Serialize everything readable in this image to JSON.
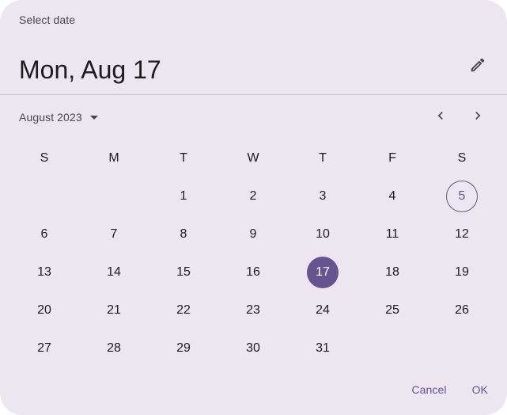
{
  "dialog": {
    "label": "Select date",
    "headline": "Mon, Aug 17",
    "edit_icon": "pencil-icon",
    "month_label": "August 2023",
    "prev_icon": "chevron-left-icon",
    "next_icon": "chevron-right-icon",
    "weekdays": [
      "S",
      "M",
      "T",
      "W",
      "T",
      "F",
      "S"
    ],
    "days": [
      "",
      "",
      "1",
      "2",
      "3",
      "4",
      "5",
      "6",
      "7",
      "8",
      "9",
      "10",
      "11",
      "12",
      "13",
      "14",
      "15",
      "16",
      "17",
      "18",
      "19",
      "20",
      "21",
      "22",
      "23",
      "24",
      "25",
      "26",
      "27",
      "28",
      "29",
      "30",
      "31",
      "",
      ""
    ],
    "today": "5",
    "selected": "17",
    "cancel_label": "Cancel",
    "ok_label": "OK"
  },
  "colors": {
    "surface": "#ece6f0",
    "primary": "#65558f",
    "on_surface": "#1d1b20",
    "on_surface_variant": "#49454f",
    "divider": "#cac4d0"
  }
}
